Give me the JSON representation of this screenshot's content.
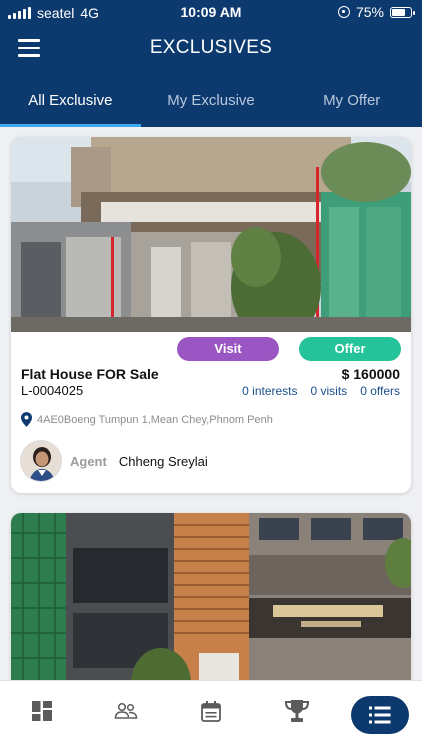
{
  "status_bar": {
    "carrier": "seatel",
    "network": "4G",
    "time": "10:09 AM",
    "battery_percent": "75%",
    "battery_level": 0.75
  },
  "app_bar": {
    "title": "EXCLUSIVES",
    "menu_icon": "hamburger-menu-icon"
  },
  "tabs": [
    {
      "label": "All Exclusive",
      "active": true
    },
    {
      "label": "My Exclusive",
      "active": false
    },
    {
      "label": "My Offer",
      "active": false
    }
  ],
  "listings": [
    {
      "title": "Flat House FOR Sale",
      "code": "L-0004025",
      "price": "$ 160000",
      "visit_label": "Visit",
      "offer_label": "Offer",
      "interests": "0 interests",
      "visits": "0 visits",
      "offers": "0 offers",
      "address": "4AE0Boeng Tumpun 1,Mean Chey,Phnom Penh",
      "agent_label": "Agent",
      "agent_name": "Chheng Sreylai"
    }
  ],
  "bottom_nav": [
    {
      "icon": "dashboard-icon",
      "active": false
    },
    {
      "icon": "people-icon",
      "active": false
    },
    {
      "icon": "calendar-icon",
      "active": false
    },
    {
      "icon": "trophy-icon",
      "active": false
    },
    {
      "icon": "list-icon",
      "active": true
    }
  ],
  "colors": {
    "primary": "#0d3a6e",
    "tab_indicator": "#3fa9f5",
    "visit_button": "#9a56c2",
    "offer_button": "#25c39a",
    "stats_text": "#1c4f8d"
  }
}
